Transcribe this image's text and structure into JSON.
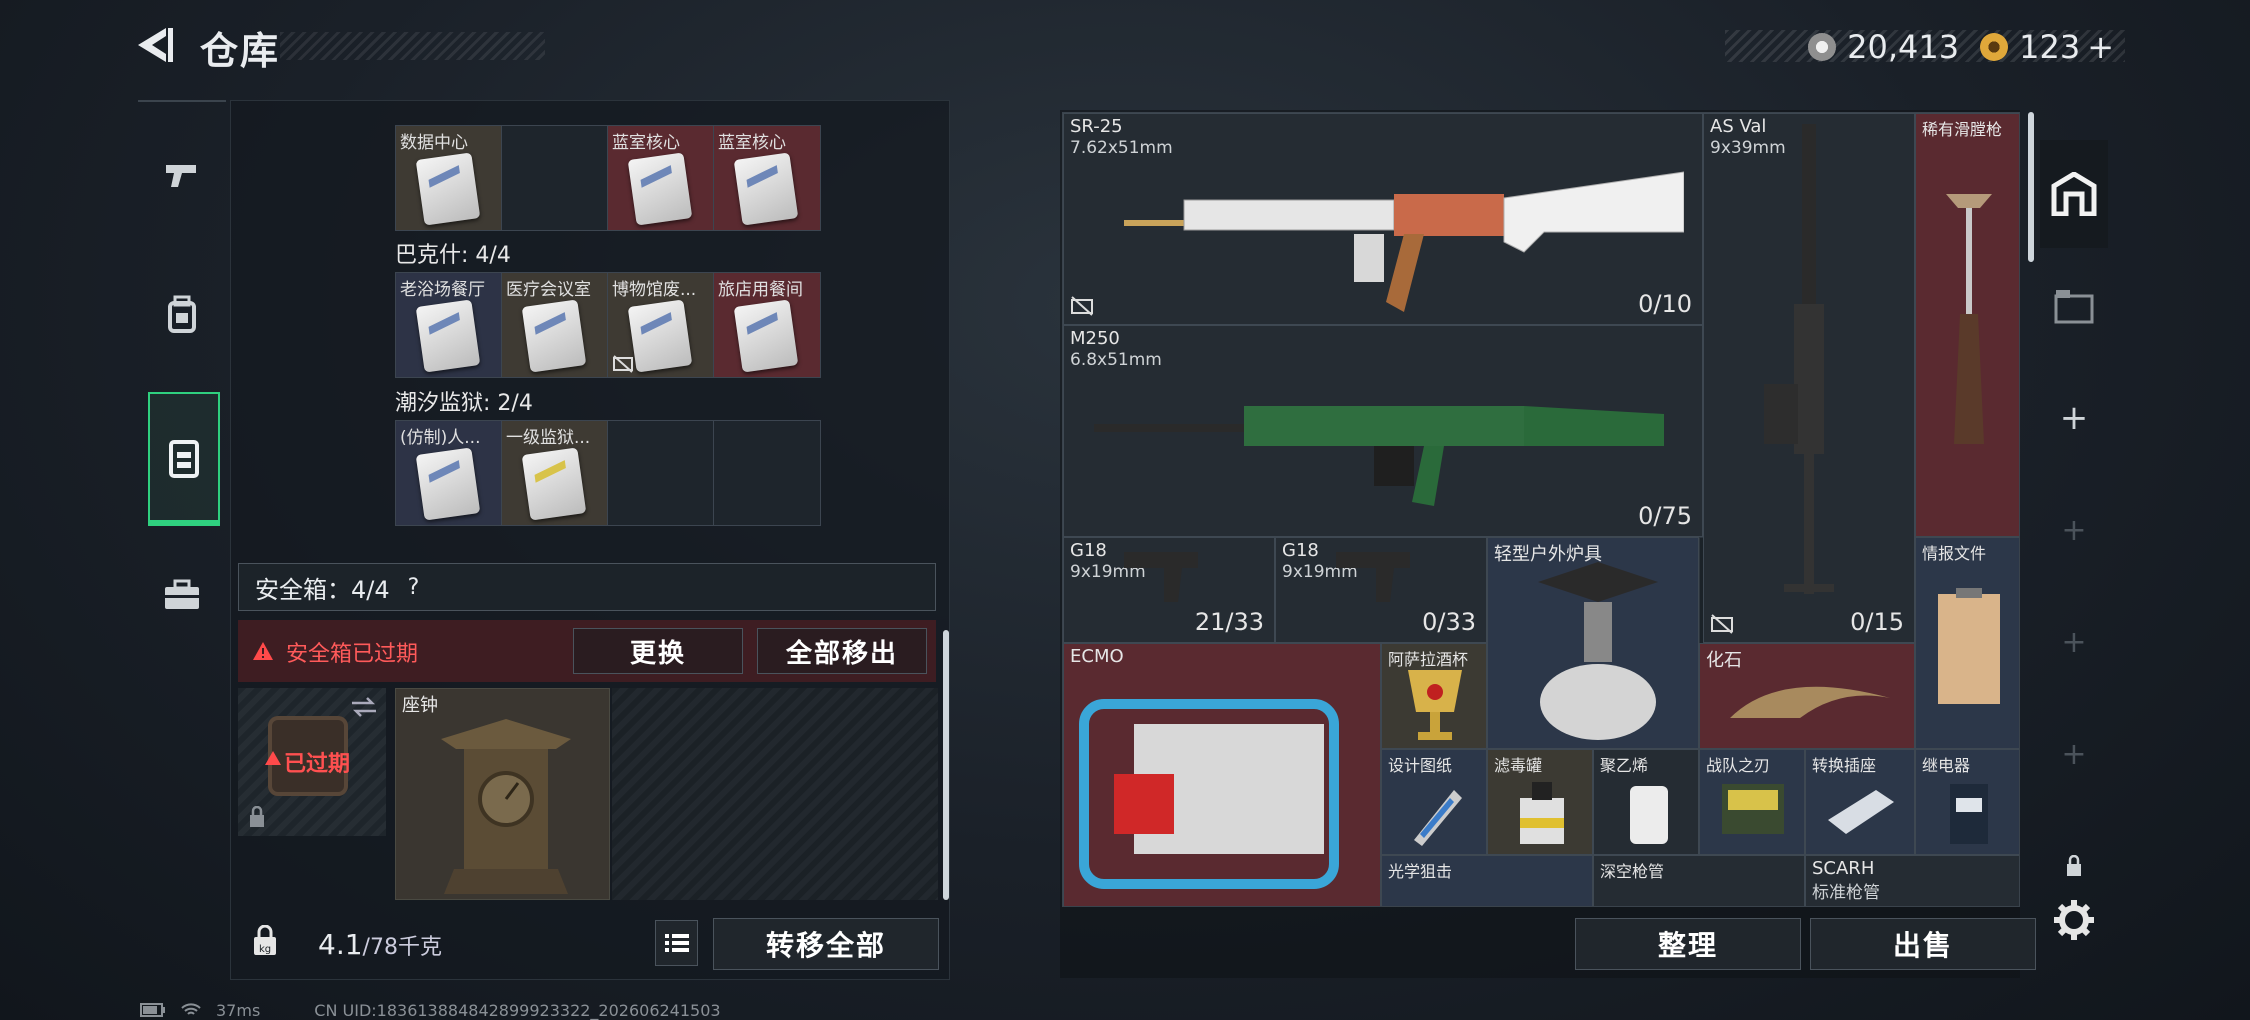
{
  "header": {
    "title": "仓库",
    "currency": [
      {
        "icon": "silver-coin-icon",
        "value": "20,413"
      },
      {
        "icon": "gold-coin-icon",
        "value": "123",
        "plus": "+"
      }
    ]
  },
  "nav": [
    "pistol-icon",
    "backpack-icon",
    "chest-rig-icon",
    "case-icon"
  ],
  "left": {
    "group0": {
      "slots": [
        {
          "name": "数据中心",
          "color": "tan"
        },
        {
          "name": "",
          "color": "empty"
        },
        {
          "name": "蓝室核心",
          "color": "red"
        },
        {
          "name": "蓝室核心",
          "color": "red"
        }
      ]
    },
    "group1": {
      "label": "巴克什: 4/4",
      "slots": [
        {
          "name": "老浴场餐厅",
          "color": "blue"
        },
        {
          "name": "医疗会议室",
          "color": "tan"
        },
        {
          "name": "博物馆废...",
          "color": "tan"
        },
        {
          "name": "旅店用餐间",
          "color": "red"
        }
      ]
    },
    "group2": {
      "label": "潮汐监狱: 2/4",
      "slots": [
        {
          "name": "(仿制)人...",
          "color": "blue"
        },
        {
          "name": "一级监狱...",
          "color": "tan"
        }
      ]
    },
    "safebox": {
      "label": "安全箱：4/4",
      "help": "?",
      "warning": "安全箱已过期",
      "replace": "更换",
      "move_all_out": "全部移出",
      "expired": "已过期",
      "item": "座钟"
    },
    "weight": {
      "value": "4.1",
      "unit": "/78千克"
    },
    "transfer_all": "转移全部"
  },
  "right": {
    "items": {
      "sr25": {
        "name": "SR-25",
        "cal": "7.62x51mm",
        "ammo": "0/10"
      },
      "asval": {
        "name": "AS Val",
        "cal": "9x39mm",
        "ammo": "0/15"
      },
      "rare": {
        "name": "稀有滑膛枪"
      },
      "m250": {
        "name": "M250",
        "cal": "6.8x51mm",
        "ammo": "0/75"
      },
      "g18a": {
        "name": "G18",
        "cal": "9x19mm",
        "ammo": "21/33"
      },
      "g18b": {
        "name": "G18",
        "cal": "9x19mm",
        "ammo": "0/33"
      },
      "stove": {
        "name": "轻型户外炉具"
      },
      "intel": {
        "name": "情报文件"
      },
      "ecmo": {
        "name": "ECMO"
      },
      "cup": {
        "name": "阿萨拉酒杯"
      },
      "fossil": {
        "name": "化石"
      },
      "design": {
        "name": "设计图纸"
      },
      "canister": {
        "name": "滤毒罐"
      },
      "pe": {
        "name": "聚乙烯"
      },
      "blade": {
        "name": "战队之刃"
      },
      "socket": {
        "name": "转换插座"
      },
      "relay": {
        "name": "继电器"
      },
      "scope": {
        "name": "光学狙击"
      },
      "barrel": {
        "name": "深空枪管"
      },
      "scarh": {
        "name": "SCARH",
        "sub": "标准枪管"
      }
    },
    "sort": "整理",
    "sell": "出售"
  },
  "status": {
    "ping": "37ms",
    "uid": "CN UID:183613884842899923322_202606241503"
  }
}
